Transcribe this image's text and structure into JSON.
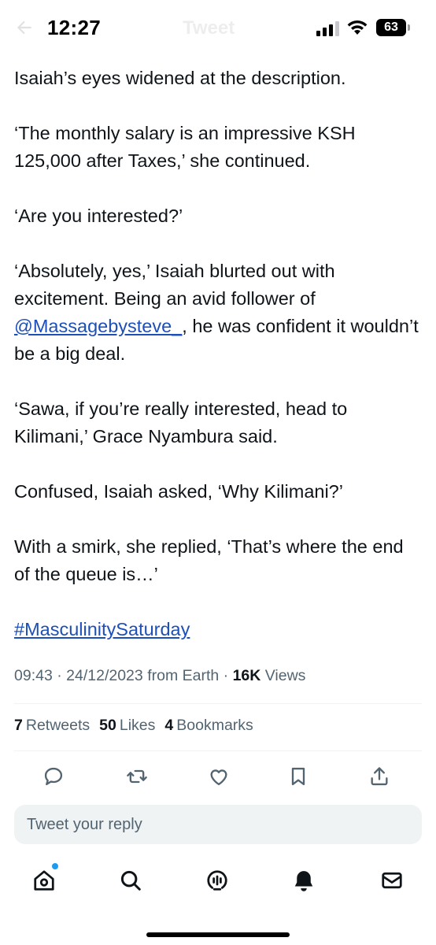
{
  "status_bar": {
    "time": "12:27",
    "battery": "63"
  },
  "nav": {
    "title": "Tweet"
  },
  "tweet": {
    "paragraphs": [
      "Isaiah’s eyes widened at the description.",
      "‘The monthly salary is an impressive KSH 125,000 after Taxes,’ she continued.",
      "‘Are you interested?’",
      "‘Sawa, if you’re really interested, head to Kilimani,’ Grace Nyambura said.",
      "Confused, Isaiah asked, ‘Why Kilimani?’",
      "With a smirk, she replied, ‘That’s where the end of the queue is…’"
    ],
    "p4_before": "‘Absolutely, yes,’ Isaiah blurted out with excitement. Being an avid follower of ",
    "mention": "@Massagebysteve_",
    "p4_after": ", he was confident it wouldn’t be a big deal.",
    "hashtag": "#MasculinitySaturday"
  },
  "meta": {
    "time": "09:43",
    "date": "24/12/2023",
    "source": "from Earth",
    "views_count": "16K",
    "views_label": "Views",
    "separator": "·"
  },
  "stats": [
    {
      "count": "7",
      "label": "Retweets"
    },
    {
      "count": "50",
      "label": "Likes"
    },
    {
      "count": "4",
      "label": "Bookmarks"
    }
  ],
  "actions": {
    "icons": [
      "reply-icon",
      "retweet-icon",
      "like-icon",
      "bookmark-icon",
      "share-icon"
    ]
  },
  "reply": {
    "placeholder": "Tweet your reply"
  },
  "tabbar": {
    "icons": [
      "home-icon",
      "search-icon",
      "spaces-icon",
      "notifications-icon",
      "messages-icon"
    ]
  },
  "colors": {
    "link": "#1d4fb8",
    "text": "#0f1419",
    "muted": "#536471",
    "accent": "#1d9bf0",
    "reply_bg": "#eff3f4"
  }
}
